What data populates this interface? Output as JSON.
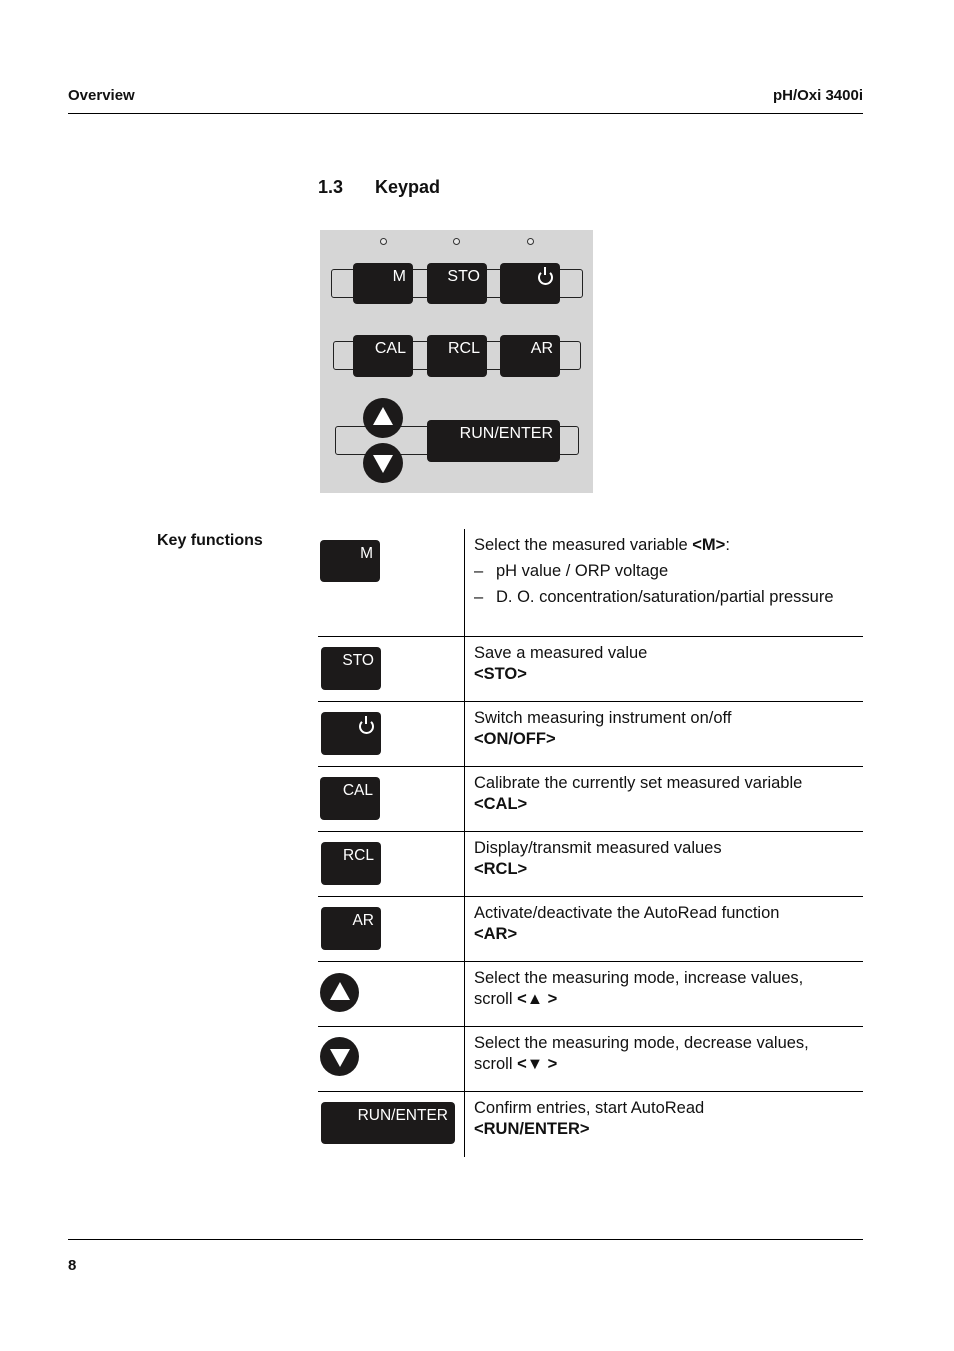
{
  "header": {
    "section": "Overview",
    "product": "pH/Oxi 3400i"
  },
  "section": {
    "number": "1.3",
    "title": "Keypad"
  },
  "keypad": {
    "row1": [
      "M",
      "STO",
      "power-icon"
    ],
    "row2": [
      "CAL",
      "RCL",
      "AR"
    ],
    "row3": {
      "up": "up-arrow",
      "down": "down-arrow",
      "enter": "RUN/ENTER"
    },
    "colors": {
      "panel": "#d6d6d6",
      "key": "#1c1a1a",
      "key_text": "#ffffff"
    }
  },
  "key_functions": {
    "label": "Key functions",
    "rows": [
      {
        "key": "M",
        "desc": "Select the measured variable ",
        "code": "<M>",
        "suffix": ":",
        "bullets": [
          "pH value / ORP voltage",
          "D. O. concentration/saturation/partial pressure"
        ]
      },
      {
        "key": "STO",
        "desc": "Save a measured value",
        "code": "<STO>"
      },
      {
        "key": "power",
        "desc": "Switch measuring instrument on/off",
        "code": "<ON/OFF>"
      },
      {
        "key": "CAL",
        "desc": "Calibrate the currently set measured variable",
        "code": "<CAL>"
      },
      {
        "key": "RCL",
        "desc": "Display/transmit measured values",
        "code": "<RCL>"
      },
      {
        "key": "AR",
        "desc": "Activate/deactivate the AutoRead function",
        "code": "<AR>"
      },
      {
        "key": "up",
        "desc": "Select the measuring mode, increase values,",
        "desc2": "scroll ",
        "code": "<▲ >"
      },
      {
        "key": "down",
        "desc": "Select the measuring mode, decrease values,",
        "desc2": "scroll ",
        "code": "<▼ >"
      },
      {
        "key": "RUN/ENTER",
        "desc": "Confirm entries, start AutoRead",
        "code": "<RUN/ENTER>"
      }
    ]
  },
  "footer": {
    "page": "8"
  }
}
